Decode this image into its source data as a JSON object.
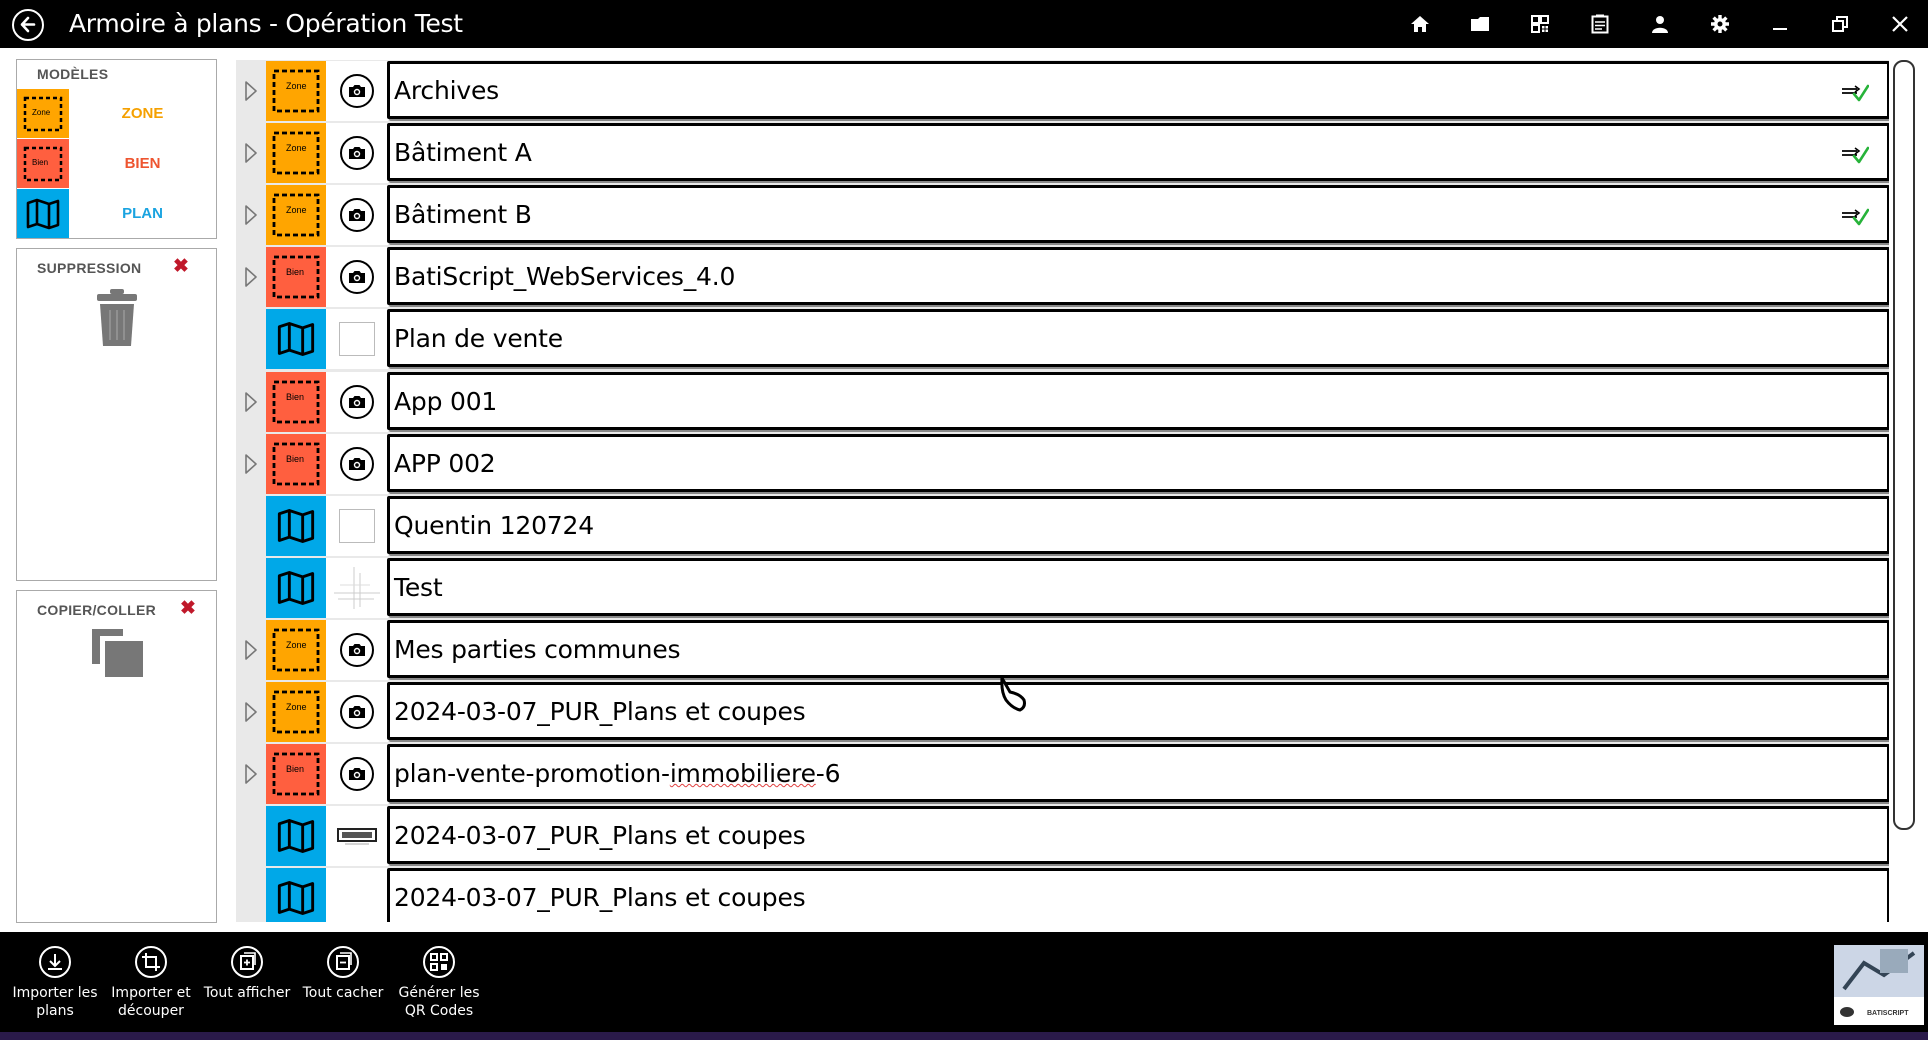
{
  "window": {
    "title": "Armoire à plans - Opération Test"
  },
  "toolbar": {
    "buttons": [
      {
        "name": "home-icon"
      },
      {
        "name": "folder-icon"
      },
      {
        "name": "qr-code-icon"
      },
      {
        "name": "clipboard-icon"
      },
      {
        "name": "user-icon"
      },
      {
        "name": "gear-icon"
      },
      {
        "name": "minimize-icon"
      },
      {
        "name": "restore-icon"
      },
      {
        "name": "close-icon"
      }
    ]
  },
  "sidebar": {
    "models": {
      "title": "MODÈLES",
      "items": [
        {
          "label": "ZONE",
          "tile_text": "Zone",
          "color": "#ffa500"
        },
        {
          "label": "BIEN",
          "tile_text": "Bien",
          "color": "#ff5f3f"
        },
        {
          "label": "PLAN",
          "color": "#00a8e8"
        }
      ]
    },
    "delete": {
      "title": "SUPPRESSION"
    },
    "copy": {
      "title": "COPIER/COLLER"
    }
  },
  "list": {
    "rows": [
      {
        "type": "zone",
        "label": "Archives",
        "expandable": true,
        "thumb": "camera",
        "synced": true
      },
      {
        "type": "zone",
        "label": "Bâtiment A",
        "expandable": true,
        "thumb": "camera",
        "synced": true
      },
      {
        "type": "zone",
        "label": "Bâtiment B",
        "expandable": true,
        "thumb": "camera",
        "synced": true
      },
      {
        "type": "bien",
        "label": "BatiScript_WebServices_4.0",
        "expandable": true,
        "thumb": "camera",
        "synced": false
      },
      {
        "type": "plan",
        "label": "Plan de vente",
        "expandable": false,
        "thumb": "blank",
        "synced": false
      },
      {
        "type": "bien",
        "label": "App 001",
        "expandable": true,
        "thumb": "camera",
        "synced": false
      },
      {
        "type": "bien",
        "label": "APP 002",
        "expandable": true,
        "thumb": "camera",
        "synced": false
      },
      {
        "type": "plan",
        "label": "Quentin 120724",
        "expandable": false,
        "thumb": "blank",
        "synced": false
      },
      {
        "type": "plan",
        "label": "Test",
        "expandable": false,
        "thumb": "sketch",
        "synced": false
      },
      {
        "type": "zone",
        "label": "Mes parties communes",
        "expandable": true,
        "thumb": "camera",
        "synced": false
      },
      {
        "type": "zone",
        "label": "2024-03-07_PUR_Plans et coupes",
        "expandable": true,
        "thumb": "camera",
        "synced": false
      },
      {
        "type": "bien",
        "label": "plan-vente-promotion-",
        "label_spell": "immobiliere",
        "label_end": "-6",
        "expandable": true,
        "thumb": "camera",
        "synced": false
      },
      {
        "type": "plan",
        "label": "2024-03-07_PUR_Plans et coupes",
        "expandable": false,
        "thumb": "drawing",
        "synced": false
      },
      {
        "type": "plan",
        "label": "2024-03-07_PUR_Plans et coupes",
        "expandable": false,
        "thumb": "none",
        "synced": false
      }
    ]
  },
  "bottombar": {
    "buttons": [
      {
        "name": "import-plans-button",
        "icon": "download-icon",
        "line1": "Importer les",
        "line2": "plans"
      },
      {
        "name": "import-crop-button",
        "icon": "crop-icon",
        "line1": "Importer et",
        "line2": "découper"
      },
      {
        "name": "show-all-button",
        "icon": "expand-all-icon",
        "line1": "Tout afficher",
        "line2": ""
      },
      {
        "name": "hide-all-button",
        "icon": "collapse-all-icon",
        "line1": "Tout cacher",
        "line2": ""
      },
      {
        "name": "generate-qr-button",
        "icon": "qr-code-icon",
        "line1": "Générer les",
        "line2": "QR Codes"
      }
    ],
    "logo_text": "BATISCRIPT"
  },
  "colors": {
    "zone": "#ffa500",
    "bien": "#ff5f3f",
    "plan": "#00a8e8",
    "delete_x": "#c0182a"
  }
}
